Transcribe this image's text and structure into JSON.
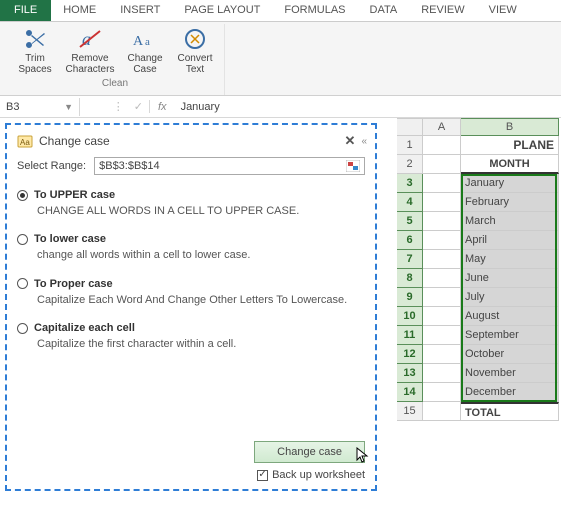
{
  "ribbon": {
    "tabs": [
      "FILE",
      "HOME",
      "INSERT",
      "PAGE LAYOUT",
      "FORMULAS",
      "DATA",
      "REVIEW",
      "VIEW"
    ],
    "group": {
      "name": "Clean",
      "buttons": [
        {
          "label1": "Trim",
          "label2": "Spaces"
        },
        {
          "label1": "Remove",
          "label2": "Characters"
        },
        {
          "label1": "Change",
          "label2": "Case"
        },
        {
          "label1": "Convert",
          "label2": "Text"
        }
      ]
    }
  },
  "formula_bar": {
    "name_box": "B3",
    "fx": "fx",
    "value": "January"
  },
  "pane": {
    "title": "Change case",
    "select_label": "Select Range:",
    "range": "$B$3:$B$14",
    "options": [
      {
        "label": "To UPPER case",
        "desc": "CHANGE ALL WORDS IN A CELL TO UPPER CASE.",
        "checked": true
      },
      {
        "label": "To lower case",
        "desc": "change all words within a cell to lower case.",
        "checked": false
      },
      {
        "label": "To Proper case",
        "desc": "Capitalize Each Word And Change Other Letters To Lowercase.",
        "checked": false
      },
      {
        "label": "Capitalize each cell",
        "desc": "Capitalize the first character within a cell.",
        "checked": false
      }
    ],
    "button": "Change case",
    "backup": "Back up worksheet",
    "backup_checked": true
  },
  "grid": {
    "columns": [
      "A",
      "B"
    ],
    "b1": "PLANE",
    "b2": "MONTH",
    "rows": [
      "January",
      "February",
      "March",
      "April",
      "May",
      "June",
      "July",
      "August",
      "September",
      "October",
      "November",
      "December"
    ],
    "total": "TOTAL"
  }
}
